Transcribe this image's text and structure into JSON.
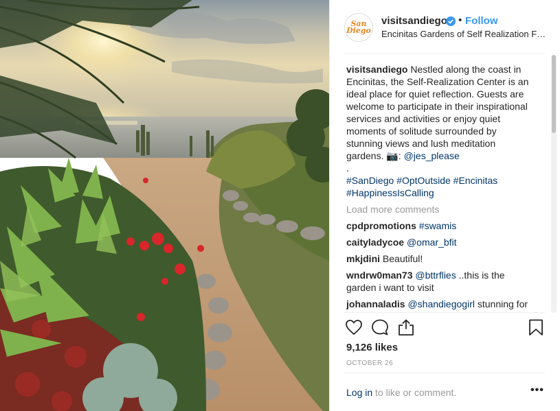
{
  "post": {
    "username": "visitsandiego",
    "avatar_text_1": "San",
    "avatar_text_2": "Diego",
    "dot": "•",
    "follow_label": "Follow",
    "location": "Encinitas Gardens of Self Realization Fellowship",
    "caption": {
      "username": "visitsandiego",
      "text": " Nestled along the coast in Encinitas, the Self-Realization Center is an ideal place for quiet reflection. Guests are welcome to participate in their inspirational services and activities or enjoy quiet moments of solitude surrounded by stunning views and lush meditation gardens. 📷: ",
      "mention": "@jes_please",
      "period": ".",
      "hashtags": "#SanDiego #OptOutside #Encinitas #HappinessIsCalling"
    },
    "load_more": "Load more comments",
    "comments": [
      {
        "user": "cpdpromotions",
        "tag": "#swamis",
        "text": ""
      },
      {
        "user": "caityladycoe",
        "tag": "@omar_bfit",
        "text": ""
      },
      {
        "user": "mkjdini",
        "tag": "",
        "text": "Beautiful!"
      },
      {
        "user": "wndrw0man73",
        "tag": "@bttrflies",
        "text": " ..this is the garden i want to visit"
      },
      {
        "user": "johannaladis",
        "tag": "@shandiegogirl",
        "text": " stunning for"
      }
    ],
    "likes": "9,126 likes",
    "date": "OCTOBER 26",
    "login_link": "Log in",
    "login_text": " to like or comment.",
    "more": "•••",
    "colors": {
      "accent": "#3897f0",
      "link": "#003569",
      "muted": "#999999",
      "text": "#262626"
    }
  }
}
